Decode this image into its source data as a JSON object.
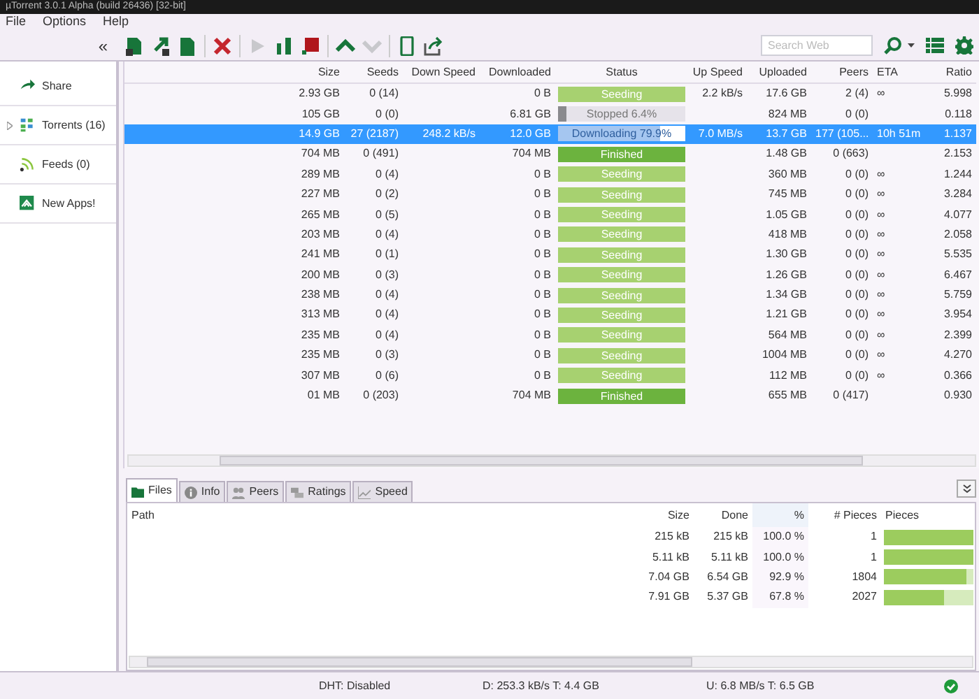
{
  "window": {
    "title": "µTorrent 3.0.1 Alpha (build 26436) [32-bit]"
  },
  "menu": [
    "File",
    "Options",
    "Help"
  ],
  "toolbar": {
    "collapse": "«",
    "buttons": [
      {
        "kind": "add",
        "disabled": false
      },
      {
        "kind": "link",
        "disabled": false
      },
      {
        "kind": "create",
        "disabled": false
      },
      {
        "kind": "remove",
        "disabled": false
      },
      {
        "kind": "start",
        "disabled": true
      },
      {
        "kind": "pause",
        "disabled": false
      },
      {
        "kind": "stop",
        "disabled": false
      },
      {
        "kind": "up",
        "disabled": false
      },
      {
        "kind": "down",
        "disabled": true
      },
      {
        "kind": "device",
        "disabled": false
      },
      {
        "kind": "share",
        "disabled": false
      }
    ],
    "search": {
      "placeholder": "Search Web"
    }
  },
  "sidebar": {
    "items": [
      {
        "kind": "share",
        "label": "Share",
        "selected": false
      },
      {
        "kind": "torrents",
        "label": "Torrents (16)",
        "selected": false
      },
      {
        "kind": "feeds",
        "label": "Feeds (0)",
        "selected": false
      },
      {
        "kind": "apps",
        "label": "New Apps!",
        "selected": false
      }
    ]
  },
  "table": {
    "columns": [
      "Size",
      "Seeds",
      "Down Speed",
      "Downloaded",
      "Status",
      "Up Speed",
      "Uploaded",
      "Peers",
      "ETA",
      "Ratio"
    ],
    "rows": [
      {
        "size": "2.93 GB",
        "seeds": "0 (14)",
        "down_speed": "",
        "downloaded": "0 B",
        "status": {
          "kind": "seeding",
          "label": "Seeding",
          "level": 1
        },
        "up_speed": "2.2 kB/s",
        "uploaded": "17.6 GB",
        "peers": "2 (4)",
        "eta": "∞",
        "ratio": "5.998",
        "selected": false
      },
      {
        "size": "105 GB",
        "seeds": "0 (0)",
        "down_speed": "",
        "downloaded": "6.81 GB",
        "status": {
          "kind": "stopped",
          "label": "Stopped 6.4%",
          "level": 0.064
        },
        "up_speed": "",
        "uploaded": "824 MB",
        "peers": "0 (0)",
        "eta": "",
        "ratio": "0.118",
        "selected": false
      },
      {
        "size": "14.9 GB",
        "seeds": "27 (2187)",
        "down_speed": "248.2 kB/s",
        "downloaded": "12.0 GB",
        "status": {
          "kind": "downloading",
          "label": "Downloading 79.9%",
          "level": 0.799
        },
        "up_speed": "7.0 MB/s",
        "uploaded": "13.7 GB",
        "peers": "177 (105...",
        "eta": "10h 51m",
        "ratio": "1.137",
        "selected": true
      },
      {
        "size": "704 MB",
        "seeds": "0 (491)",
        "down_speed": "",
        "downloaded": "704 MB",
        "status": {
          "kind": "finished",
          "label": "Finished",
          "level": 1
        },
        "up_speed": "",
        "uploaded": "1.48 GB",
        "peers": "0 (663)",
        "eta": "",
        "ratio": "2.153",
        "selected": false
      },
      {
        "size": "289 MB",
        "seeds": "0 (4)",
        "down_speed": "",
        "downloaded": "0 B",
        "status": {
          "kind": "seeding",
          "label": "Seeding",
          "level": 1
        },
        "up_speed": "",
        "uploaded": "360 MB",
        "peers": "0 (0)",
        "eta": "∞",
        "ratio": "1.244",
        "selected": false
      },
      {
        "size": "227 MB",
        "seeds": "0 (2)",
        "down_speed": "",
        "downloaded": "0 B",
        "status": {
          "kind": "seeding",
          "label": "Seeding",
          "level": 1
        },
        "up_speed": "",
        "uploaded": "745 MB",
        "peers": "0 (0)",
        "eta": "∞",
        "ratio": "3.284",
        "selected": false
      },
      {
        "size": "265 MB",
        "seeds": "0 (5)",
        "down_speed": "",
        "downloaded": "0 B",
        "status": {
          "kind": "seeding",
          "label": "Seeding",
          "level": 1
        },
        "up_speed": "",
        "uploaded": "1.05 GB",
        "peers": "0 (0)",
        "eta": "∞",
        "ratio": "4.077",
        "selected": false
      },
      {
        "size": "203 MB",
        "seeds": "0 (4)",
        "down_speed": "",
        "downloaded": "0 B",
        "status": {
          "kind": "seeding",
          "label": "Seeding",
          "level": 1
        },
        "up_speed": "",
        "uploaded": "418 MB",
        "peers": "0 (0)",
        "eta": "∞",
        "ratio": "2.058",
        "selected": false
      },
      {
        "size": "241 MB",
        "seeds": "0 (1)",
        "down_speed": "",
        "downloaded": "0 B",
        "status": {
          "kind": "seeding",
          "label": "Seeding",
          "level": 1
        },
        "up_speed": "",
        "uploaded": "1.30 GB",
        "peers": "0 (0)",
        "eta": "∞",
        "ratio": "5.535",
        "selected": false
      },
      {
        "size": "200 MB",
        "seeds": "0 (3)",
        "down_speed": "",
        "downloaded": "0 B",
        "status": {
          "kind": "seeding",
          "label": "Seeding",
          "level": 1
        },
        "up_speed": "",
        "uploaded": "1.26 GB",
        "peers": "0 (0)",
        "eta": "∞",
        "ratio": "6.467",
        "selected": false
      },
      {
        "size": "238 MB",
        "seeds": "0 (4)",
        "down_speed": "",
        "downloaded": "0 B",
        "status": {
          "kind": "seeding",
          "label": "Seeding",
          "level": 1
        },
        "up_speed": "",
        "uploaded": "1.34 GB",
        "peers": "0 (0)",
        "eta": "∞",
        "ratio": "5.759",
        "selected": false
      },
      {
        "size": "313 MB",
        "seeds": "0 (4)",
        "down_speed": "",
        "downloaded": "0 B",
        "status": {
          "kind": "seeding",
          "label": "Seeding",
          "level": 1
        },
        "up_speed": "",
        "uploaded": "1.21 GB",
        "peers": "0 (0)",
        "eta": "∞",
        "ratio": "3.954",
        "selected": false
      },
      {
        "size": "235 MB",
        "seeds": "0 (4)",
        "down_speed": "",
        "downloaded": "0 B",
        "status": {
          "kind": "seeding",
          "label": "Seeding",
          "level": 1
        },
        "up_speed": "",
        "uploaded": "564 MB",
        "peers": "0 (0)",
        "eta": "∞",
        "ratio": "2.399",
        "selected": false
      },
      {
        "size": "235 MB",
        "seeds": "0 (3)",
        "down_speed": "",
        "downloaded": "0 B",
        "status": {
          "kind": "seeding",
          "label": "Seeding",
          "level": 1
        },
        "up_speed": "",
        "uploaded": "1004 MB",
        "peers": "0 (0)",
        "eta": "∞",
        "ratio": "4.270",
        "selected": false
      },
      {
        "size": "307 MB",
        "seeds": "0 (6)",
        "down_speed": "",
        "downloaded": "0 B",
        "status": {
          "kind": "seeding",
          "label": "Seeding",
          "level": 1
        },
        "up_speed": "",
        "uploaded": "112 MB",
        "peers": "0 (0)",
        "eta": "∞",
        "ratio": "0.366",
        "selected": false
      },
      {
        "size": "01 MB",
        "seeds": "0 (203)",
        "down_speed": "",
        "downloaded": "704 MB",
        "status": {
          "kind": "finished",
          "label": "Finished",
          "level": 1
        },
        "up_speed": "",
        "uploaded": "655 MB",
        "peers": "0 (417)",
        "eta": "",
        "ratio": "0.930",
        "selected": false
      }
    ]
  },
  "detail_tabs": [
    {
      "kind": "files",
      "label": "Files",
      "selected": true
    },
    {
      "kind": "info",
      "label": "Info",
      "selected": false
    },
    {
      "kind": "peers",
      "label": "Peers",
      "selected": false
    },
    {
      "kind": "ratings",
      "label": "Ratings",
      "selected": false
    },
    {
      "kind": "speed",
      "label": "Speed",
      "selected": false
    }
  ],
  "files": {
    "columns": [
      "Path",
      "Size",
      "Done",
      "%",
      "# Pieces",
      "Pieces"
    ],
    "rows": [
      {
        "size": "215 kB",
        "done": "215 kB",
        "percent": "100.0 %",
        "pieces": "1",
        "level": 1
      },
      {
        "size": "5.11 kB",
        "done": "5.11 kB",
        "percent": "100.0 %",
        "pieces": "1",
        "level": 1
      },
      {
        "size": "7.04 GB",
        "done": "6.54 GB",
        "percent": "92.9 %",
        "pieces": "1804",
        "level": 0.929
      },
      {
        "size": "7.91 GB",
        "done": "5.37 GB",
        "percent": "67.8 %",
        "pieces": "2027",
        "level": 0.678
      }
    ]
  },
  "status_bar": {
    "dht": "DHT: Disabled",
    "download": "D: 253.3 kB/s T: 4.4 GB",
    "upload": "U: 6.8 MB/s T: 6.5 GB"
  }
}
